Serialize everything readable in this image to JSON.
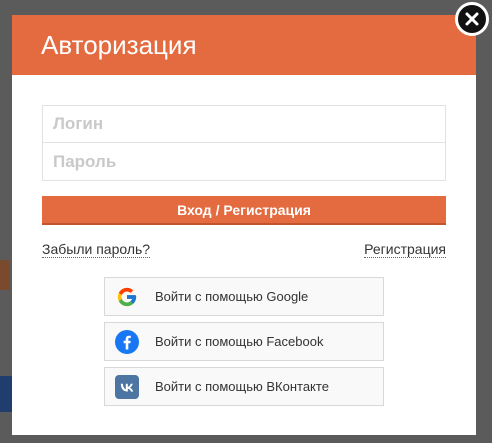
{
  "modal": {
    "title": "Авторизация"
  },
  "form": {
    "login_placeholder": "Логин",
    "password_placeholder": "Пароль",
    "submit_label": "Вход / Регистрация"
  },
  "links": {
    "forgot_password": "Забыли пароль?",
    "register": "Регистрация"
  },
  "social": [
    {
      "label": "Войти с помощью Google",
      "icon": "google-icon"
    },
    {
      "label": "Войти с помощью Facebook",
      "icon": "facebook-icon"
    },
    {
      "label": "Войти с помощью ВКонтакте",
      "icon": "vk-icon"
    }
  ],
  "colors": {
    "accent": "#e46a3f",
    "facebook": "#3b5998",
    "vk": "#4c75a3"
  }
}
